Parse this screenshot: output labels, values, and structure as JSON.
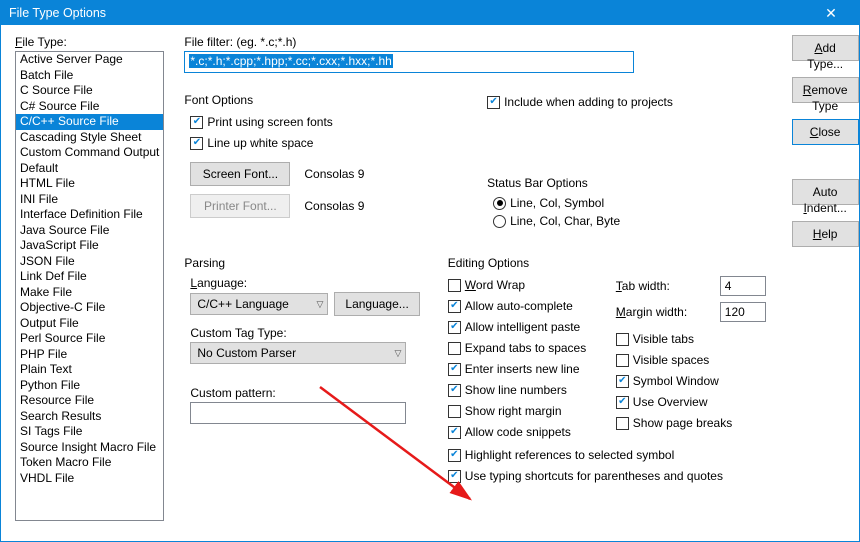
{
  "window": {
    "title": "File Type Options"
  },
  "labels": {
    "file_type": "File Type:",
    "file_filter": "File filter: (eg. *.c;*.h)",
    "font_options": "Font Options",
    "status_bar": "Status Bar Options",
    "parsing": "Parsing",
    "language": "Language:",
    "custom_tag": "Custom Tag Type:",
    "custom_pattern": "Custom pattern:",
    "editing_options": "Editing Options",
    "tab_width": "Tab width:",
    "margin_width": "Margin width:"
  },
  "filter_value": "*.c;*.h;*.cpp;*.hpp;*.cc;*.cxx;*.hxx;*.hh",
  "file_types": [
    "Active Server Page",
    "Batch File",
    "C Source File",
    "C# Source File",
    "C/C++ Source File",
    "Cascading Style Sheet",
    "Custom Command Output",
    "Default",
    "HTML File",
    "INI File",
    "Interface Definition File",
    "Java Source File",
    "JavaScript File",
    "JSON File",
    "Link Def File",
    "Make File",
    "Objective-C File",
    "Output File",
    "Perl Source File",
    "PHP File",
    "Plain Text",
    "Python File",
    "Resource File",
    "Search Results",
    "SI Tags File",
    "Source Insight Macro File",
    "Token Macro File",
    "VHDL File"
  ],
  "selected_file_type": "C/C++ Source File",
  "font_opts": {
    "print_using": "Print using screen fonts",
    "lineup": "Line up white space",
    "screen_font_btn": "Screen Font...",
    "printer_font_btn": "Printer Font...",
    "font_name": "Consolas 9"
  },
  "include_projects": "Include when adding to projects",
  "status": {
    "opt1": "Line, Col, Symbol",
    "opt2": "Line, Col, Char, Byte"
  },
  "parsing": {
    "language_value": "C/C++ Language",
    "language_btn": "Language...",
    "custom_tag_value": "No Custom Parser",
    "custom_pattern_value": ""
  },
  "editing": {
    "word_wrap": "Word Wrap",
    "auto_complete": "Allow auto-complete",
    "intelligent_paste": "Allow intelligent paste",
    "expand_tabs": "Expand tabs to spaces",
    "enter_newline": "Enter inserts new line",
    "show_line_numbers": "Show line numbers",
    "show_right_margin": "Show right margin",
    "allow_snippets": "Allow code snippets",
    "highlight_refs": "Highlight references to selected symbol",
    "typing_shortcuts": "Use typing shortcuts for parentheses and quotes",
    "visible_tabs": "Visible tabs",
    "visible_spaces": "Visible spaces",
    "symbol_window": "Symbol Window",
    "use_overview": "Use Overview",
    "show_page_breaks": "Show page breaks",
    "tab_width_value": "4",
    "margin_width_value": "120"
  },
  "buttons": {
    "add_type": "Add Type...",
    "remove_type": "Remove Type",
    "close": "Close",
    "auto_indent": "Auto Indent...",
    "help": "Help"
  }
}
